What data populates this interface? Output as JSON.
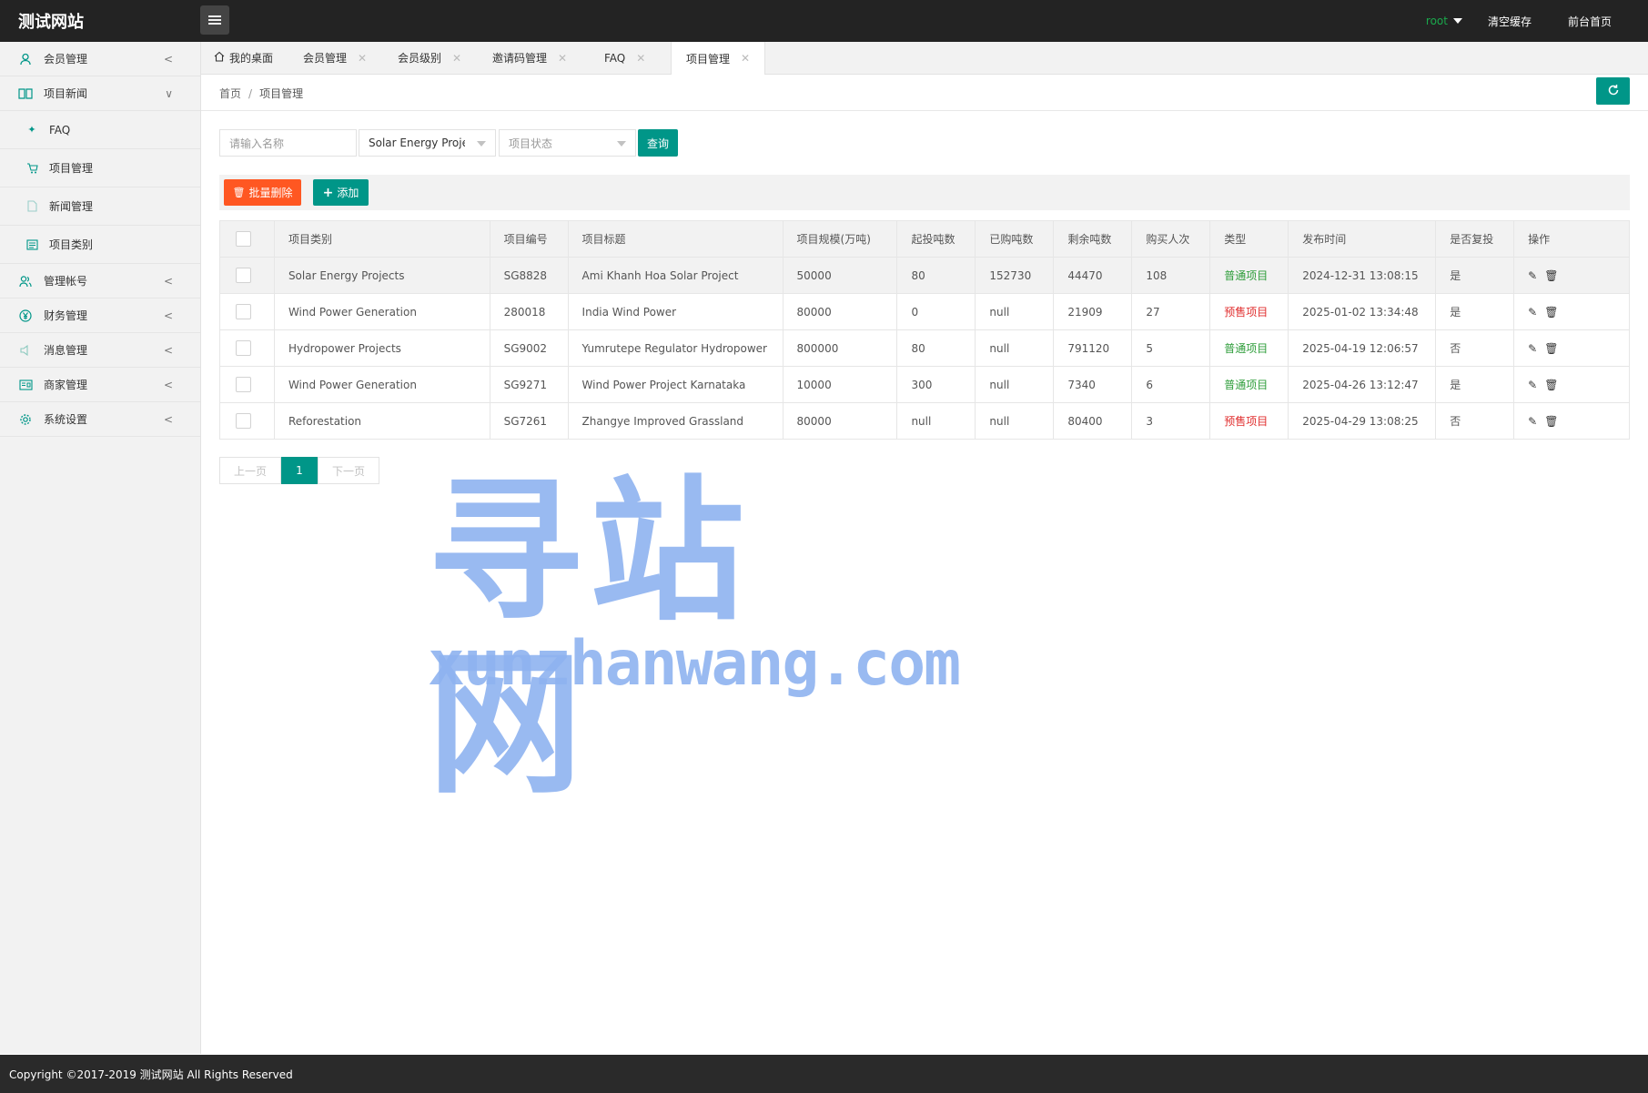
{
  "header": {
    "logo": "测试网站",
    "user": "root",
    "clear_cache": "清空缓存",
    "front_home": "前台首页"
  },
  "sidebar": {
    "items": [
      {
        "label": "会员管理",
        "icon": "user-icon",
        "expanded": false
      },
      {
        "label": "项目新闻",
        "icon": "book-icon",
        "expanded": true
      },
      {
        "label": "管理帐号",
        "icon": "users-icon",
        "expanded": false
      },
      {
        "label": "财务管理",
        "icon": "yen-icon",
        "expanded": false
      },
      {
        "label": "消息管理",
        "icon": "speaker-icon",
        "expanded": false
      },
      {
        "label": "商家管理",
        "icon": "store-icon",
        "expanded": false
      },
      {
        "label": "系统设置",
        "icon": "gear-icon",
        "expanded": false
      }
    ],
    "sub_items": [
      {
        "label": "FAQ",
        "icon": "tree-icon"
      },
      {
        "label": "项目管理",
        "icon": "cart-icon"
      },
      {
        "label": "新闻管理",
        "icon": "doc-icon"
      },
      {
        "label": "项目类别",
        "icon": "list-icon"
      }
    ]
  },
  "tabs": [
    {
      "label": "我的桌面",
      "closable": false,
      "active": false
    },
    {
      "label": "会员管理",
      "closable": true,
      "active": false
    },
    {
      "label": "会员级别",
      "closable": true,
      "active": false
    },
    {
      "label": "邀请码管理",
      "closable": true,
      "active": false
    },
    {
      "label": "FAQ",
      "closable": true,
      "active": false
    },
    {
      "label": "项目管理",
      "closable": true,
      "active": true
    }
  ],
  "breadcrumb": {
    "home": "首页",
    "sep": "/",
    "current": "项目管理"
  },
  "filter": {
    "name_placeholder": "请输入名称",
    "category_value": "Solar Energy Projects",
    "status_placeholder": "项目状态",
    "search_label": "查询"
  },
  "toolbar": {
    "batch_delete": "批量删除",
    "add": "添加"
  },
  "table": {
    "headers": [
      "项目类别",
      "项目编号",
      "项目标题",
      "项目规模(万吨)",
      "起投吨数",
      "已购吨数",
      "剩余吨数",
      "购买人次",
      "类型",
      "发布时间",
      "是否复投",
      "操作"
    ],
    "rows": [
      {
        "category": "Solar Energy Projects",
        "code": "SG8828",
        "title": "Ami Khanh Hoa Solar Project",
        "scale": "50000",
        "min": "80",
        "bought": "152730",
        "remain": "44470",
        "buyers": "108",
        "type": "普通项目",
        "type_color": "#2e9d3a",
        "time": "2024-12-31 13:08:15",
        "reinvest": "是"
      },
      {
        "category": "Wind Power Generation",
        "code": "280018",
        "title": "India Wind Power",
        "scale": "80000",
        "min": "0",
        "bought": "null",
        "remain": "21909",
        "buyers": "27",
        "type": "预售项目",
        "type_color": "#e02d2d",
        "time": "2025-01-02 13:34:48",
        "reinvest": "是"
      },
      {
        "category": "Hydropower Projects",
        "code": "SG9002",
        "title": "Yumrutepe Regulator Hydropower",
        "scale": "800000",
        "min": "80",
        "bought": "null",
        "remain": "791120",
        "buyers": "5",
        "type": "普通项目",
        "type_color": "#2e9d3a",
        "time": "2025-04-19 12:06:57",
        "reinvest": "否"
      },
      {
        "category": "Wind Power Generation",
        "code": "SG9271",
        "title": "Wind Power Project Karnataka",
        "scale": "10000",
        "min": "300",
        "bought": "null",
        "remain": "7340",
        "buyers": "6",
        "type": "普通项目",
        "type_color": "#2e9d3a",
        "time": "2025-04-26 13:12:47",
        "reinvest": "是"
      },
      {
        "category": "Reforestation",
        "code": "SG7261",
        "title": "Zhangye Improved Grassland",
        "scale": "80000",
        "min": "null",
        "bought": "null",
        "remain": "80400",
        "buyers": "3",
        "type": "预售项目",
        "type_color": "#e02d2d",
        "time": "2025-04-29 13:08:25",
        "reinvest": "否"
      }
    ]
  },
  "pager": {
    "prev": "上一页",
    "current": "1",
    "next": "下一页"
  },
  "watermark": {
    "cn": "寻站网",
    "en": "xunzhanwang.com"
  },
  "footer": {
    "text": "Copyright ©2017-2019 测试网站 All Rights Reserved"
  },
  "colors": {
    "accent": "#009688",
    "danger": "#ff5722",
    "header_bg": "#232323"
  }
}
